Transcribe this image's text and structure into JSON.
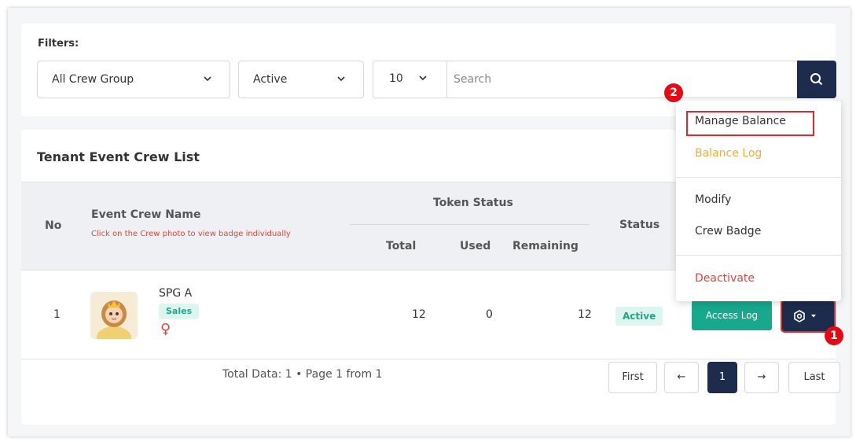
{
  "filters": {
    "label": "Filters:",
    "crew_group": "All Crew Group",
    "status": "Active",
    "per_page": "10",
    "search_placeholder": "Search"
  },
  "list": {
    "title": "Tenant Event Crew List",
    "headers": {
      "no": "No",
      "name": "Event Crew Name",
      "name_hint": "Click on the Crew photo to view badge individually",
      "token_status": "Token Status",
      "total": "Total",
      "used": "Used",
      "remaining": "Remaining",
      "status": "Status"
    },
    "rows": [
      {
        "no": "1",
        "name": "SPG A",
        "group": "Sales",
        "gender_symbol": "♀",
        "total": "12",
        "used": "0",
        "remaining": "12",
        "status": "Active",
        "access_log": "Access Log"
      }
    ],
    "footer_info": "Total Data: 1 • Page 1 from 1"
  },
  "pagination": {
    "first": "First",
    "prev": "←",
    "current": "1",
    "next": "→",
    "last": "Last"
  },
  "action_menu": {
    "manage_balance": "Manage Balance",
    "balance_log": "Balance Log",
    "modify": "Modify",
    "crew_badge": "Crew Badge",
    "deactivate": "Deactivate"
  },
  "markers": {
    "one": "1",
    "two": "2"
  },
  "colors": {
    "navy": "#1d2b4d",
    "teal": "#17a88d",
    "danger": "#e2453a",
    "warning": "#f0ae3c",
    "highlight": "#e02a2a"
  }
}
